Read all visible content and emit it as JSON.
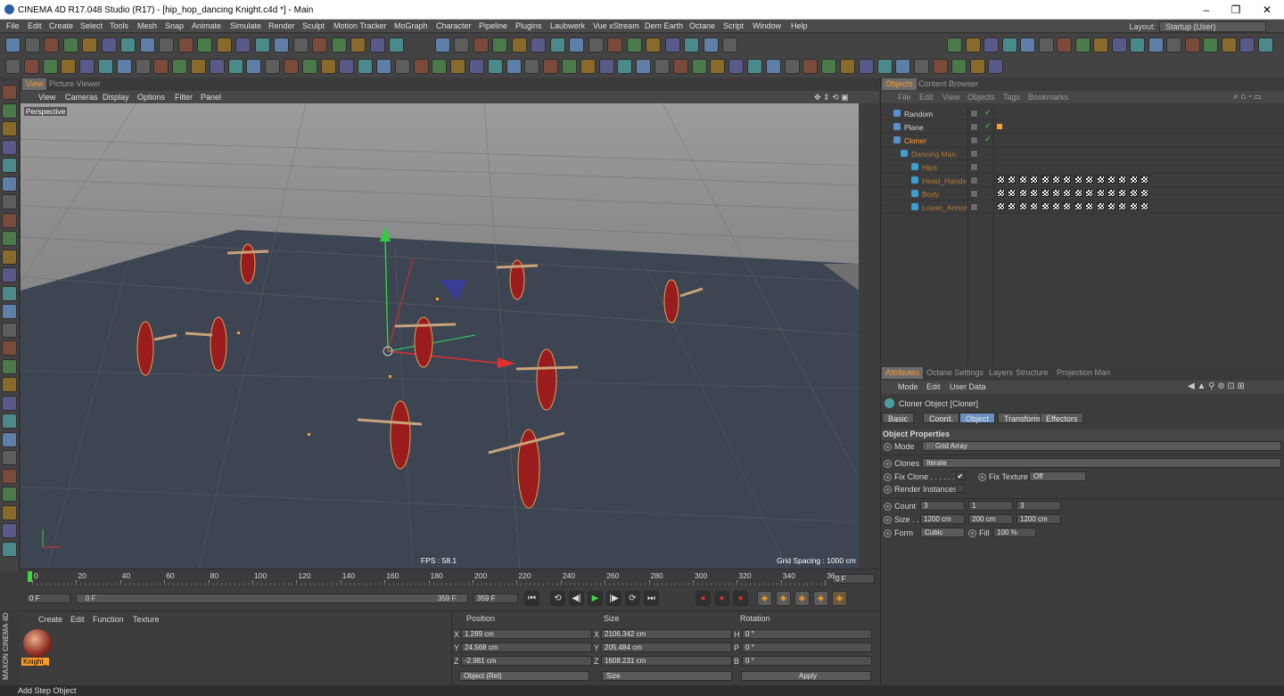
{
  "window": {
    "title": "CINEMA 4D R17.048 Studio (R17) - [hip_hop_dancing Knight.c4d *] - Main",
    "min": "–",
    "max": "❐",
    "close": "✕"
  },
  "menu": [
    "File",
    "Edit",
    "Create",
    "Select",
    "Tools",
    "Mesh",
    "Snap",
    "Animate",
    "Simulate",
    "Render",
    "Sculpt",
    "Motion Tracker",
    "MoGraph",
    "Character",
    "Pipeline",
    "Plugins",
    "Laubwerk",
    "Vue xStream",
    "Dem Earth",
    "Octane",
    "Script",
    "Window",
    "Help"
  ],
  "layout": {
    "label": "Layout:",
    "value": "Startup (User)"
  },
  "viewport": {
    "tabs": [
      "View",
      "Picture Viewer"
    ],
    "menu": [
      "View",
      "Cameras",
      "Display",
      "Options",
      "Filter",
      "Panel"
    ],
    "label": "Perspective",
    "fps": "FPS : 58.1",
    "grid": "Grid Spacing : 1000 cm"
  },
  "timeline": {
    "ticks": [
      "0",
      "20",
      "40",
      "60",
      "80",
      "100",
      "120",
      "140",
      "160",
      "180",
      "200",
      "220",
      "240",
      "260",
      "280",
      "300",
      "320",
      "340",
      "36"
    ],
    "frame_end": "0 F"
  },
  "transport": {
    "start": "0 F",
    "slider_start": "0 F",
    "slider_end": "359 F",
    "end": "359 F"
  },
  "material": {
    "menu": [
      "Create",
      "Edit",
      "Function",
      "Texture"
    ],
    "item": "Knight_"
  },
  "coords": {
    "headers": [
      "Position",
      "Size",
      "Rotation"
    ],
    "rows": [
      {
        "a": "X",
        "p": "1.289 cm",
        "b": "X",
        "s": "2106.342 cm",
        "c": "H",
        "r": "0 °"
      },
      {
        "a": "Y",
        "p": "24.568 cm",
        "b": "Y",
        "s": "205.484 cm",
        "c": "P",
        "r": "0 °"
      },
      {
        "a": "Z",
        "p": "-2.981 cm",
        "b": "Z",
        "s": "1608.231 cm",
        "c": "B",
        "r": "0 °"
      }
    ],
    "mode": "Object (Rel)",
    "size_mode": "Size",
    "apply": "Apply"
  },
  "status": "Add Step Object",
  "objects": {
    "tabs": [
      "Objects",
      "Content Browser"
    ],
    "menu": [
      "File",
      "Edit",
      "View",
      "Objects",
      "Tags",
      "Bookmarks"
    ],
    "rows": [
      {
        "name": "Random",
        "color": "#d8d8d8",
        "indent": 14
      },
      {
        "name": "Plane",
        "color": "#d8d8d8",
        "indent": 14
      },
      {
        "name": "Cloner",
        "color": "#ff9d2b",
        "indent": 14
      },
      {
        "name": "Dancing Man",
        "color": "#b07a36",
        "indent": 22
      },
      {
        "name": "Hips",
        "color": "#b07a36",
        "indent": 34
      },
      {
        "name": "Head_Hands",
        "color": "#b07a36",
        "indent": 34
      },
      {
        "name": "Body",
        "color": "#b07a36",
        "indent": 34
      },
      {
        "name": "Lower_Armor",
        "color": "#b07a36",
        "indent": 34
      }
    ]
  },
  "attributes": {
    "tabs": [
      "Attributes",
      "Octane Settings",
      "Layers",
      "Structure",
      "Projection Man"
    ],
    "menu": [
      "Mode",
      "Edit",
      "User Data"
    ],
    "object_title": "Cloner Object [Cloner]",
    "subtabs": [
      "Basic",
      "Coord.",
      "Object",
      "Transform",
      "Effectors"
    ],
    "section": "Object Properties",
    "mode_label": "Mode",
    "mode_value": "Grid Array",
    "clones_label": "Clones",
    "clones_value": "Iterate",
    "fix_clone": "Fix Clone . . . . . .",
    "fix_clone_check": "✔",
    "fix_texture": "Fix Texture",
    "fix_texture_value": "Off",
    "render_instances": "Render Instances",
    "count_label": "Count",
    "count": [
      "3",
      "1",
      "3"
    ],
    "size_label": "Size . .",
    "size": [
      "1200 cm",
      "200 cm",
      "1200 cm"
    ],
    "form_label": "Form",
    "form_value": "Cubic",
    "fill_label": "Fill",
    "fill_value": "100 %"
  }
}
